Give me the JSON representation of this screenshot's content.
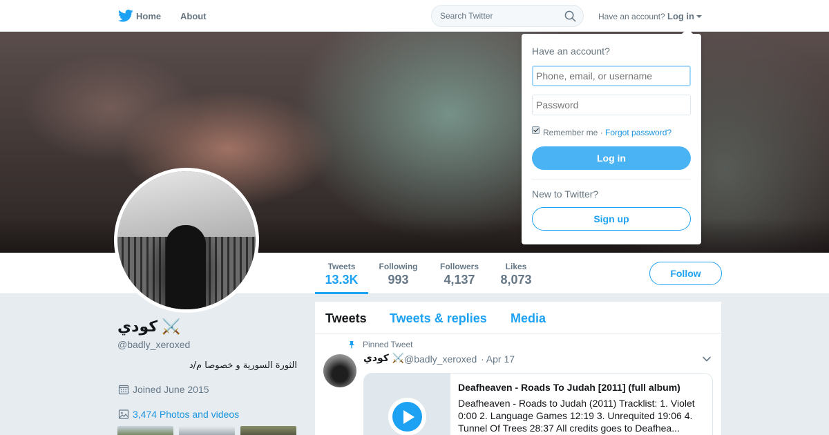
{
  "nav": {
    "home_label": "Home",
    "about_label": "About",
    "search_placeholder": "Search Twitter",
    "have_account": "Have an account?",
    "login_label": "Log in"
  },
  "profile": {
    "name": "كودي ⚔️",
    "handle": "@badly_xeroxed",
    "bio": "الثورة السورية و خصوصا م/د",
    "joined": "Joined June 2015",
    "photos_link": "3,474 Photos and videos",
    "follow_label": "Follow"
  },
  "stats": [
    {
      "label": "Tweets",
      "value": "13.3K",
      "active": true
    },
    {
      "label": "Following",
      "value": "993",
      "active": false
    },
    {
      "label": "Followers",
      "value": "4,137",
      "active": false
    },
    {
      "label": "Likes",
      "value": "8,073",
      "active": false
    }
  ],
  "timeline": {
    "tabs": [
      "Tweets",
      "Tweets & replies",
      "Media"
    ],
    "pinned_label": "Pinned Tweet",
    "tweet": {
      "name": "كودي ⚔️",
      "handle": "@badly_xeroxed",
      "date": "· Apr 17",
      "card_title": "Deafheaven - Roads To Judah [2011] (full album)",
      "card_description": "Deafheaven - Roads to Judah (2011) Tracklist: 1. Violet 0:00 2. Language Games 12:19 3. Unrequited 19:06 4. Tunnel Of Trees 28:37 All credits goes to Deafhea..."
    }
  },
  "login_dropdown": {
    "heading": "Have an account?",
    "username_placeholder": "Phone, email, or username",
    "password_placeholder": "Password",
    "remember_me": "Remember me ·",
    "forgot_password": "Forgot password?",
    "login_button": "Log in",
    "new_to_twitter": "New to Twitter?",
    "signup_button": "Sign up"
  },
  "colors": {
    "accent": "#1da1f2",
    "link": "#1b95e0",
    "page_background": "#e6ecf0"
  },
  "icons": [
    "twitter-bird-icon",
    "search-icon",
    "calendar-icon",
    "photo-icon",
    "pin-icon",
    "chevron-down-icon",
    "play-icon"
  ]
}
